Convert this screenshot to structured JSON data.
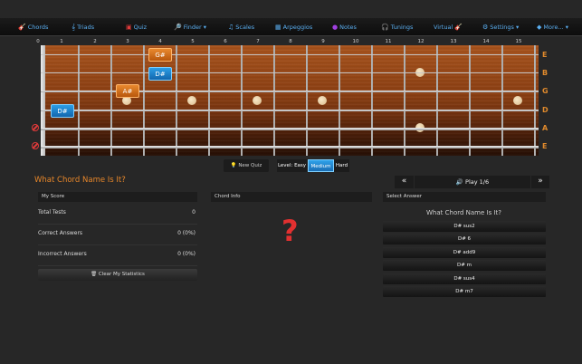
{
  "nav": [
    {
      "icon": "🎸",
      "label": "Chords"
    },
    {
      "icon": "𝄞",
      "label": "Triads"
    },
    {
      "icon": "▣",
      "label": "Quiz"
    },
    {
      "icon": "🔎",
      "label": "Finder ▾"
    },
    {
      "icon": "♫",
      "label": "Scales"
    },
    {
      "icon": "▦",
      "label": "Arpeggios"
    },
    {
      "icon": "●",
      "label": "Notes"
    },
    {
      "icon": "🎧",
      "label": "Tunings"
    },
    {
      "icon": "🎸",
      "label": "Virtual"
    },
    {
      "icon": "⚙",
      "label": "Settings ▾"
    },
    {
      "icon": "◆",
      "label": "More... ▾"
    }
  ],
  "fret_numbers": [
    "0",
    "1",
    "2",
    "3",
    "4",
    "5",
    "6",
    "7",
    "8",
    "9",
    "10",
    "11",
    "12",
    "13",
    "14",
    "15"
  ],
  "string_names": [
    "E",
    "B",
    "G",
    "D",
    "A",
    "E"
  ],
  "notes": [
    {
      "label": "G#",
      "color": "orange",
      "fret": 4,
      "string": 1
    },
    {
      "label": "D#",
      "color": "blue",
      "fret": 4,
      "string": 2
    },
    {
      "label": "A#",
      "color": "orange",
      "fret": 3,
      "string": 3
    },
    {
      "label": "D#",
      "color": "blue",
      "fret": 1,
      "string": 4
    }
  ],
  "muted_strings": [
    5,
    6
  ],
  "quiz_controls": {
    "new_quiz": "New Quiz",
    "level_prefix": "Level:",
    "easy": "Easy",
    "medium": "Medium",
    "hard": "Hard",
    "active_level": "Medium"
  },
  "section_title": "What Chord Name Is It?",
  "score": {
    "header": "My Score",
    "total_label": "Total Tests",
    "total_value": "0",
    "correct_label": "Correct Answers",
    "correct_value": "0 (0%)",
    "incorrect_label": "Incorrect Answers",
    "incorrect_value": "0 (0%)",
    "clear_label": "Clear My Statistics"
  },
  "chord_info": {
    "header": "Chord Info",
    "question_mark": "?"
  },
  "answer": {
    "prev": "«",
    "next": "»",
    "play": "🔊 Play 1/6",
    "header": "Select Answer",
    "question": "What Chord Name Is It?",
    "options": [
      "D# sus2",
      "D# 6",
      "D# add9",
      "D# m",
      "D# sus4",
      "D# m7"
    ]
  }
}
